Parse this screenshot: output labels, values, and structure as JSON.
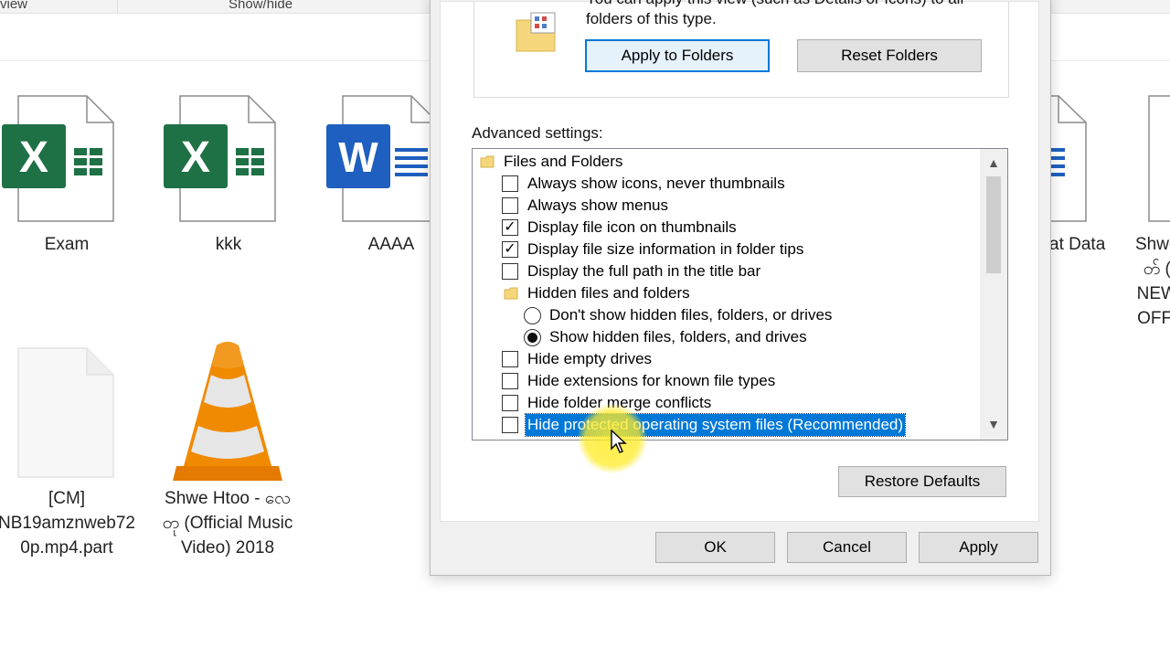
{
  "ribbon": {
    "view_label": "view",
    "showhide_label": "Show/hide"
  },
  "files": [
    {
      "name": "Exam",
      "type": "excel"
    },
    {
      "name": "kkk",
      "type": "excel"
    },
    {
      "name": "AAAA",
      "type": "word"
    },
    {
      "name": "at Data",
      "type": "word"
    },
    {
      "name_lines": [
        "Shwe",
        "တ် (",
        "NEW",
        "OFFI"
      ],
      "type": "file"
    },
    {
      "name_lines": [
        "[CM]",
        "NB19amznweb72",
        "0p.mp4.part"
      ],
      "type": "file"
    },
    {
      "name_lines": [
        "Shwe Htoo - လေ",
        "တု (Official Music",
        "Video) 2018"
      ],
      "type": "vlc"
    }
  ],
  "dialog": {
    "description_lines": [
      "You can apply this view (such as Details or Icons) to all",
      "folders of this type."
    ],
    "apply_to_folders": "Apply to Folders",
    "reset_folders": "Reset Folders",
    "advanced_label": "Advanced settings:",
    "tree_items": [
      {
        "kind": "folder",
        "label": "Files and Folders",
        "level": 0
      },
      {
        "kind": "checkbox",
        "checked": false,
        "label": "Always show icons, never thumbnails",
        "level": 1
      },
      {
        "kind": "checkbox",
        "checked": false,
        "label": "Always show menus",
        "level": 1
      },
      {
        "kind": "checkbox",
        "checked": true,
        "label": "Display file icon on thumbnails",
        "level": 1
      },
      {
        "kind": "checkbox",
        "checked": true,
        "label": "Display file size information in folder tips",
        "level": 1
      },
      {
        "kind": "checkbox",
        "checked": false,
        "label": "Display the full path in the title bar",
        "level": 1
      },
      {
        "kind": "folder",
        "label": "Hidden files and folders",
        "level": 1
      },
      {
        "kind": "radio",
        "checked": false,
        "label": "Don't show hidden files, folders, or drives",
        "level": 2
      },
      {
        "kind": "radio",
        "checked": true,
        "label": "Show hidden files, folders, and drives",
        "level": 2
      },
      {
        "kind": "checkbox",
        "checked": false,
        "label": "Hide empty drives",
        "level": 1
      },
      {
        "kind": "checkbox",
        "checked": false,
        "label": "Hide extensions for known file types",
        "level": 1
      },
      {
        "kind": "checkbox",
        "checked": false,
        "label": "Hide folder merge conflicts",
        "level": 1
      },
      {
        "kind": "checkbox",
        "checked": false,
        "label": "Hide protected operating system files (Recommended)",
        "level": 1,
        "selected": true
      }
    ],
    "restore_defaults": "Restore Defaults",
    "ok": "OK",
    "cancel": "Cancel",
    "apply": "Apply"
  },
  "icons": {
    "check": "✓",
    "scroll_up": "▲",
    "scroll_down": "▼"
  },
  "colors": {
    "selection": "#0078d7",
    "excel": "#1e7145",
    "word": "#1f5fbf",
    "vlc_orange": "#f08a00"
  }
}
